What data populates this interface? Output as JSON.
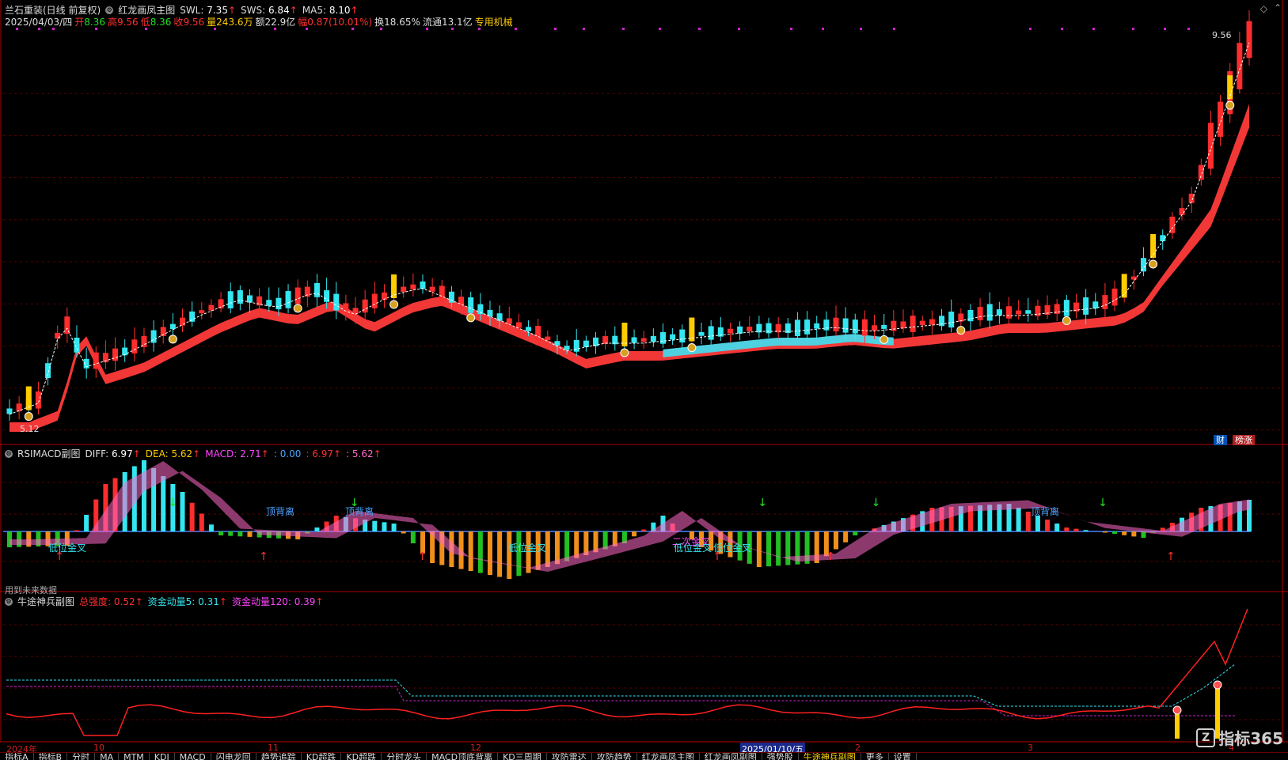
{
  "header": {
    "stock": "兰石重装(日线 前复权)",
    "indicator": "红龙画凤主图",
    "swl_label": "SWL: ",
    "swl": "7.35",
    "sws_label": "SWS: ",
    "sws": "6.84",
    "ma5_label": "MA5: ",
    "ma5": "8.10",
    "date": "2025/04/03/四",
    "open_label": "开",
    "open": "8.36",
    "high_label": "高",
    "high": "9.56",
    "low_label": "低",
    "low": "8.36",
    "close_label": "收",
    "close": "9.56",
    "vol_label": "量",
    "vol": "243.6万",
    "amt_label": "额",
    "amt": "22.9亿",
    "chg_label": "幅",
    "chg": "0.87(10.01%)",
    "turnover_label": "换",
    "turnover": "18.65%",
    "float_label": "流通",
    "float": "13.1亿",
    "tag": "专用机械",
    "up_arrow": "↑"
  },
  "price_labels": {
    "high": "9.56",
    "low": "5.12",
    "cai": "财",
    "bang": "榜涨"
  },
  "macd_panel": {
    "title": "RSIMACD副图",
    "diff_label": "DIFF: ",
    "diff": "6.97",
    "dea_label": "DEA: ",
    "dea": "5.62",
    "macd_label": "MACD: ",
    "macd": "2.71",
    "v4": ": 0.00",
    "v5": ": 6.97",
    "v6": ": 5.62",
    "future": "用到未来数据",
    "ann_low": "低位金叉",
    "ann_top": "顶背离",
    "ann_second": "二次金叉"
  },
  "bull_panel": {
    "title": "牛途神兵副图",
    "s1_label": "总强度: ",
    "s1": "0.52",
    "s2_label": "资金动量5: ",
    "s2": "0.31",
    "s3_label": "资金动量120: ",
    "s3": "0.39"
  },
  "dates": {
    "d1": "2024年",
    "d2": "10",
    "d3": "11",
    "d4": "12",
    "d5": "2025/01/10/五",
    "d6": "2",
    "d7": "3",
    "d8": "4"
  },
  "tabs": [
    "指标A",
    "指标B",
    "分时",
    "MA",
    "MTM",
    "KDJ",
    "MACD",
    "闪电龙回",
    "趋势追踪",
    "KD超跌",
    "KD超跌",
    "分时龙头",
    "MACD顶底背离",
    "KD三周期",
    "攻防雷达",
    "攻防趋势",
    "红龙画凤主图",
    "红龙画凤副图",
    "强势股",
    "牛途神兵副图",
    "更多",
    "设置"
  ],
  "watermark": "指标365",
  "colors": {
    "up": "#ff2d2d",
    "down": "#33e6f0",
    "gold": "#ffcc00",
    "green": "#22c022",
    "pink": "#ff69c8",
    "frame": "#b00000"
  }
}
